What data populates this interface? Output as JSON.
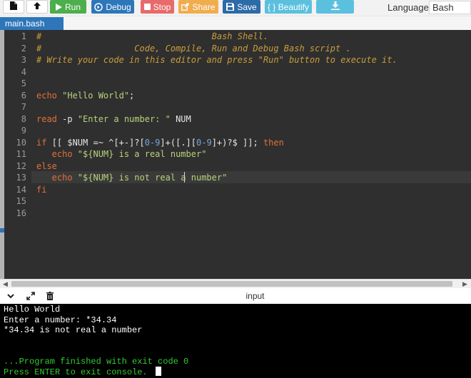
{
  "toolbar": {
    "file_icon": "file-icon",
    "upload_icon": "upload-icon",
    "run_label": "Run",
    "debug_label": "Debug",
    "stop_label": "Stop",
    "share_label": "Share",
    "save_label": "Save",
    "beautify_label": "{ } Beautify",
    "download_icon": "download-icon",
    "language_label": "Language",
    "language_value": "Bash"
  },
  "tab": {
    "label": "main.bash"
  },
  "editor": {
    "lines": [
      {
        "n": "1",
        "tokens": [
          {
            "t": "#                                 Bash Shell.",
            "c": "comment"
          }
        ]
      },
      {
        "n": "2",
        "tokens": [
          {
            "t": "#                  Code, Compile, Run and Debug Bash script .",
            "c": "comment"
          }
        ]
      },
      {
        "n": "3",
        "tokens": [
          {
            "t": "# Write your code in this editor and press \"Run\" button to execute it.",
            "c": "comment"
          }
        ]
      },
      {
        "n": "4",
        "tokens": []
      },
      {
        "n": "5",
        "tokens": []
      },
      {
        "n": "6",
        "tokens": [
          {
            "t": "echo ",
            "c": "keyword"
          },
          {
            "t": "\"Hello World\"",
            "c": "string"
          },
          {
            "t": ";",
            "c": "plain"
          }
        ]
      },
      {
        "n": "7",
        "tokens": []
      },
      {
        "n": "8",
        "tokens": [
          {
            "t": "read ",
            "c": "keyword"
          },
          {
            "t": "-p ",
            "c": "plain"
          },
          {
            "t": "\"Enter a number: \"",
            "c": "string"
          },
          {
            "t": " NUM",
            "c": "plain"
          }
        ]
      },
      {
        "n": "9",
        "tokens": []
      },
      {
        "n": "10",
        "tokens": [
          {
            "t": "if ",
            "c": "keyword"
          },
          {
            "t": "[[ $NUM =~ ^[+-]?[",
            "c": "plain"
          },
          {
            "t": "0-9",
            "c": "regex"
          },
          {
            "t": "]+([.][",
            "c": "plain"
          },
          {
            "t": "0-9",
            "c": "regex"
          },
          {
            "t": "]+)?$ ]]; ",
            "c": "plain"
          },
          {
            "t": "then",
            "c": "keyword"
          }
        ]
      },
      {
        "n": "11",
        "tokens": [
          {
            "t": "   echo ",
            "c": "keyword"
          },
          {
            "t": "\"${NUM} is a real number\"",
            "c": "string"
          }
        ]
      },
      {
        "n": "12",
        "tokens": [
          {
            "t": "else",
            "c": "keyword"
          }
        ]
      },
      {
        "n": "13",
        "tokens": [
          {
            "t": "   echo ",
            "c": "keyword"
          },
          {
            "t": "\"${NUM} is not real a number\"",
            "c": "string"
          }
        ]
      },
      {
        "n": "14",
        "tokens": [
          {
            "t": "fi",
            "c": "keyword"
          }
        ]
      },
      {
        "n": "15",
        "tokens": []
      },
      {
        "n": "16",
        "tokens": []
      }
    ]
  },
  "io": {
    "title": "input",
    "collapse_icon": "chevron-down-icon",
    "expand_icon": "expand-icon",
    "clear_icon": "clear-console-icon"
  },
  "console": {
    "lines": [
      {
        "text": "Hello World",
        "color": "white"
      },
      {
        "text": "Enter a number: *34.34",
        "color": "white"
      },
      {
        "text": "*34.34 is not real a number",
        "color": "white"
      },
      {
        "text": "",
        "color": "white"
      },
      {
        "text": "",
        "color": "white"
      },
      {
        "text": "...Program finished with exit code 0",
        "color": "green"
      },
      {
        "text": "Press ENTER to exit console.",
        "color": "green"
      }
    ]
  },
  "colors": {
    "run": "#4cae4c",
    "debug": "#2d76b9",
    "stop": "#e86a6a",
    "share": "#f0ad4e",
    "save": "#2d6aa8",
    "beautify": "#5bc0de",
    "editor_bg": "#2f2f2f",
    "console_bg": "#000000"
  }
}
